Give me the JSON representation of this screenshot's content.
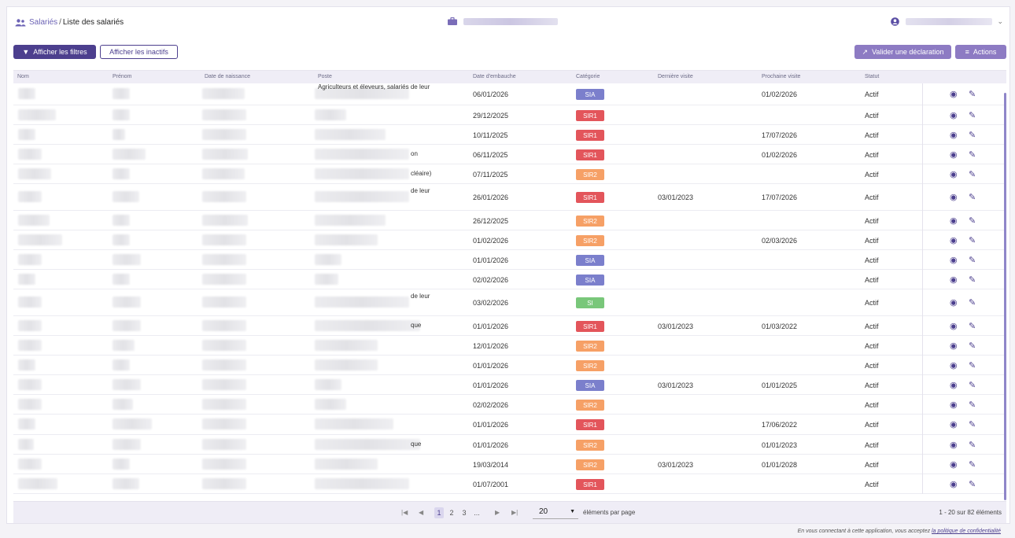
{
  "breadcrumb": {
    "parent": "Salariés",
    "separator": "/",
    "current": "Liste des salariés"
  },
  "header": {
    "company_icon": "briefcase-icon",
    "user_icon": "user-circle-icon"
  },
  "toolbar": {
    "show_filters": "Afficher les filtres",
    "show_inactive": "Afficher les inactifs",
    "validate_declaration": "Valider une déclaration",
    "actions": "Actions"
  },
  "table": {
    "columns": [
      "Nom",
      "Prénom",
      "Date de naissance",
      "Poste",
      "Date d'embauche",
      "Catégorie",
      "Dernière visite",
      "Prochaine visite",
      "Statut"
    ],
    "rows": [
      {
        "poste_tail": "Agriculteurs et éleveurs, salariés de leur",
        "hire": "06/01/2026",
        "cat": "SIA",
        "last": "",
        "next": "01/02/2026",
        "status": "Actif"
      },
      {
        "poste_tail": "",
        "hire": "29/12/2025",
        "cat": "SIR1",
        "last": "",
        "next": "",
        "status": "Actif"
      },
      {
        "poste_tail": "",
        "hire": "10/11/2025",
        "cat": "SIR1",
        "last": "",
        "next": "17/07/2026",
        "status": "Actif"
      },
      {
        "poste_tail": "on",
        "hire": "06/11/2025",
        "cat": "SIR1",
        "last": "",
        "next": "01/02/2026",
        "status": "Actif"
      },
      {
        "poste_tail": "cléaire)",
        "hire": "07/11/2025",
        "cat": "SIR2",
        "last": "",
        "next": "",
        "status": "Actif"
      },
      {
        "poste_tail": "de leur",
        "hire": "26/01/2026",
        "cat": "SIR1",
        "last": "03/01/2023",
        "next": "17/07/2026",
        "status": "Actif"
      },
      {
        "poste_tail": "",
        "hire": "26/12/2025",
        "cat": "SIR2",
        "last": "",
        "next": "",
        "status": "Actif"
      },
      {
        "poste_tail": "",
        "hire": "01/02/2026",
        "cat": "SIR2",
        "last": "",
        "next": "02/03/2026",
        "status": "Actif"
      },
      {
        "poste_tail": "",
        "hire": "01/01/2026",
        "cat": "SIA",
        "last": "",
        "next": "",
        "status": "Actif"
      },
      {
        "poste_tail": "",
        "hire": "02/02/2026",
        "cat": "SIA",
        "last": "",
        "next": "",
        "status": "Actif"
      },
      {
        "poste_tail": "de leur",
        "hire": "03/02/2026",
        "cat": "SI",
        "last": "",
        "next": "",
        "status": "Actif"
      },
      {
        "poste_tail": "que",
        "hire": "01/01/2026",
        "cat": "SIR1",
        "last": "03/01/2023",
        "next": "01/03/2022",
        "status": "Actif"
      },
      {
        "poste_tail": "",
        "hire": "12/01/2026",
        "cat": "SIR2",
        "last": "",
        "next": "",
        "status": "Actif"
      },
      {
        "poste_tail": "",
        "hire": "01/01/2026",
        "cat": "SIR2",
        "last": "",
        "next": "",
        "status": "Actif"
      },
      {
        "poste_tail": "",
        "hire": "01/01/2026",
        "cat": "SIA",
        "last": "03/01/2023",
        "next": "01/01/2025",
        "status": "Actif"
      },
      {
        "poste_tail": "",
        "hire": "02/02/2026",
        "cat": "SIR2",
        "last": "",
        "next": "",
        "status": "Actif"
      },
      {
        "poste_tail": "",
        "hire": "01/01/2026",
        "cat": "SIR1",
        "last": "",
        "next": "17/06/2022",
        "status": "Actif"
      },
      {
        "poste_tail": "que",
        "hire": "01/01/2026",
        "cat": "SIR2",
        "last": "",
        "next": "01/01/2023",
        "status": "Actif"
      },
      {
        "poste_tail": "",
        "hire": "19/03/2014",
        "cat": "SIR2",
        "last": "03/01/2023",
        "next": "01/01/2028",
        "status": "Actif"
      },
      {
        "poste_tail": "",
        "hire": "01/07/2001",
        "cat": "SIR1",
        "last": "",
        "next": "",
        "status": "Actif"
      }
    ]
  },
  "category_colors": {
    "SIA": "#7b7fcc",
    "SIR1": "#e3555b",
    "SIR2": "#f6a066",
    "SI": "#79c77a"
  },
  "pagination": {
    "pages": [
      "1",
      "2",
      "3",
      "..."
    ],
    "current_page": "1",
    "page_size": "20",
    "per_page_label": "éléments par page",
    "summary": "1 - 20 sur 82 éléments"
  },
  "footer": {
    "text": "En vous connectant à cette application, vous acceptez ",
    "link": "la politique de confidentialité"
  }
}
